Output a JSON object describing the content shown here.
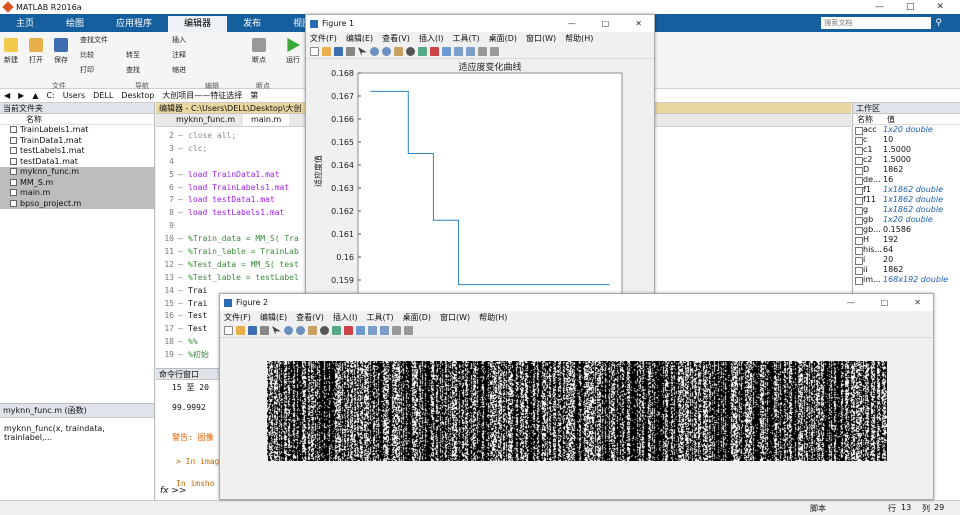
{
  "app": {
    "title": "MATLAB R2016a"
  },
  "ribbon": {
    "tabs": [
      "主页",
      "绘图",
      "应用程序",
      "编辑器",
      "发布",
      "视图"
    ],
    "buttons": [
      "新建",
      "打开",
      "保存",
      "查找文件",
      "比较",
      "打印",
      "转至",
      "查找",
      "插入",
      "注释",
      "缩进",
      "断点",
      "运行"
    ],
    "groups": [
      "文件",
      "导航",
      "编辑",
      "断点"
    ],
    "search_placeholder": "搜索文档"
  },
  "address": {
    "segments": [
      "C:",
      "Users",
      "DELL",
      "Desktop",
      "大创项目——特征选择",
      "第"
    ]
  },
  "current_folder": {
    "title": "当前文件夹",
    "column": "名称",
    "files": [
      {
        "name": "TrainLabels1.mat",
        "selected": false
      },
      {
        "name": "TrainData1.mat",
        "selected": false
      },
      {
        "name": "testLabels1.mat",
        "selected": false
      },
      {
        "name": "testData1.mat",
        "selected": false
      },
      {
        "name": "myknn_func.m",
        "selected": true
      },
      {
        "name": "MM_S.m",
        "selected": true
      },
      {
        "name": "main.m",
        "selected": true
      },
      {
        "name": "bpso_project.m",
        "selected": true
      }
    ]
  },
  "details": {
    "file": "myknn_func.m (函数)",
    "signature": "myknn_func(x, traindata, trainlabel,..."
  },
  "editor": {
    "title": "编辑器 - C:\\Users\\DELL\\Desktop\\大创",
    "tabs": [
      "myknn_func.m",
      "main.m"
    ],
    "lines": [
      {
        "n": "2",
        "t": "close all;",
        "c": "kw"
      },
      {
        "n": "3",
        "t": "clc;",
        "c": "kw"
      },
      {
        "n": "4",
        "t": "",
        "c": ""
      },
      {
        "n": "5",
        "t": "load TrainData1.mat",
        "c": "str"
      },
      {
        "n": "6",
        "t": "load TrainLabels1.mat",
        "c": "str"
      },
      {
        "n": "7",
        "t": "load testData1.mat",
        "c": "str"
      },
      {
        "n": "8",
        "t": "load testLabels1.mat",
        "c": "str"
      },
      {
        "n": "9",
        "t": "",
        "c": ""
      },
      {
        "n": "10",
        "t": "%Train_data = MM_S( Tra",
        "c": "comm"
      },
      {
        "n": "11",
        "t": "%Train_lable = TrainLab",
        "c": "comm"
      },
      {
        "n": "12",
        "t": "%Test_data = MM_S( test",
        "c": "comm"
      },
      {
        "n": "13",
        "t": "%Test_lable = testLabel",
        "c": "comm"
      },
      {
        "n": "14",
        "t": "Trai",
        "c": ""
      },
      {
        "n": "15",
        "t": "Trai",
        "c": ""
      },
      {
        "n": "16",
        "t": "Test",
        "c": ""
      },
      {
        "n": "17",
        "t": "Test",
        "c": ""
      },
      {
        "n": "18",
        "t": "%%",
        "c": "comm"
      },
      {
        "n": "19",
        "t": "%初始",
        "c": "comm"
      }
    ]
  },
  "command_window": {
    "title": "命令行窗口",
    "lines": [
      {
        "t": "15 至 20",
        "c": ""
      },
      {
        "t": "99.9992",
        "c": ""
      },
      {
        "t": "警告: 图像",
        "c": "warn"
      },
      {
        "t": "> In image",
        "c": "link"
      },
      {
        "t": "In imsho",
        "c": "link"
      },
      {
        "t": "In main",
        "c": "link"
      }
    ],
    "prompt": "fx >>"
  },
  "workspace": {
    "title": "工作区",
    "columns": [
      "名称",
      "值"
    ],
    "vars": [
      {
        "name": "acc",
        "value": "1x20 double",
        "italic": true
      },
      {
        "name": "c",
        "value": "10",
        "italic": false
      },
      {
        "name": "c1",
        "value": "1.5000",
        "italic": false
      },
      {
        "name": "c2",
        "value": "1.5000",
        "italic": false
      },
      {
        "name": "D",
        "value": "1862",
        "italic": false
      },
      {
        "name": "de...",
        "value": "16",
        "italic": false
      },
      {
        "name": "f1",
        "value": "1x1862 double",
        "italic": true
      },
      {
        "name": "f11",
        "value": "1x1862 double",
        "italic": true
      },
      {
        "name": "g",
        "value": "1x1862 double",
        "italic": true
      },
      {
        "name": "gb",
        "value": "1x20 double",
        "italic": true
      },
      {
        "name": "gb...",
        "value": "0.1586",
        "italic": false
      },
      {
        "name": "H",
        "value": "192",
        "italic": false
      },
      {
        "name": "his...",
        "value": "64",
        "italic": false
      },
      {
        "name": "i",
        "value": "20",
        "italic": false
      },
      {
        "name": "ii",
        "value": "1862",
        "italic": false
      },
      {
        "name": "im...",
        "value": "168x192 double",
        "italic": true
      }
    ]
  },
  "status": {
    "script": "脚本",
    "row_label": "行",
    "row": "13",
    "col_label": "列",
    "col": "29"
  },
  "figure1": {
    "title": "Figure 1",
    "menus": [
      "文件(F)",
      "编辑(E)",
      "查看(V)",
      "插入(I)",
      "工具(T)",
      "桌面(D)",
      "窗口(W)",
      "帮助(H)"
    ],
    "chart_title": "适应度变化曲线",
    "ylabel": "适应度值"
  },
  "figure2": {
    "title": "Figure 2",
    "menus": [
      "文件(F)",
      "编辑(E)",
      "查看(V)",
      "插入(I)",
      "工具(T)",
      "桌面(D)",
      "窗口(W)",
      "帮助(H)"
    ]
  },
  "chart_data": {
    "type": "line",
    "title": "适应度变化曲线",
    "xlabel": "",
    "ylabel": "适应度值",
    "ylim": [
      0.158,
      0.168
    ],
    "yticks": [
      "0.168",
      "0.167",
      "0.166",
      "0.165",
      "0.164",
      "0.163",
      "0.162",
      "0.161",
      "0.16",
      "0.159"
    ],
    "x": [
      1,
      2,
      3,
      4,
      5,
      6,
      7,
      8,
      9,
      10,
      11,
      12,
      13,
      14,
      15,
      16,
      17,
      18,
      19,
      20
    ],
    "series": [
      {
        "color": "#2f7fc1",
        "values": [
          0.1672,
          0.1672,
          0.1672,
          0.1645,
          0.1645,
          0.1616,
          0.1616,
          0.1588,
          0.1588,
          0.1588,
          0.1588,
          0.1588,
          0.1588,
          0.1588,
          0.1588,
          0.1588,
          0.1588,
          0.1588,
          0.1588,
          0.1588
        ]
      }
    ]
  }
}
